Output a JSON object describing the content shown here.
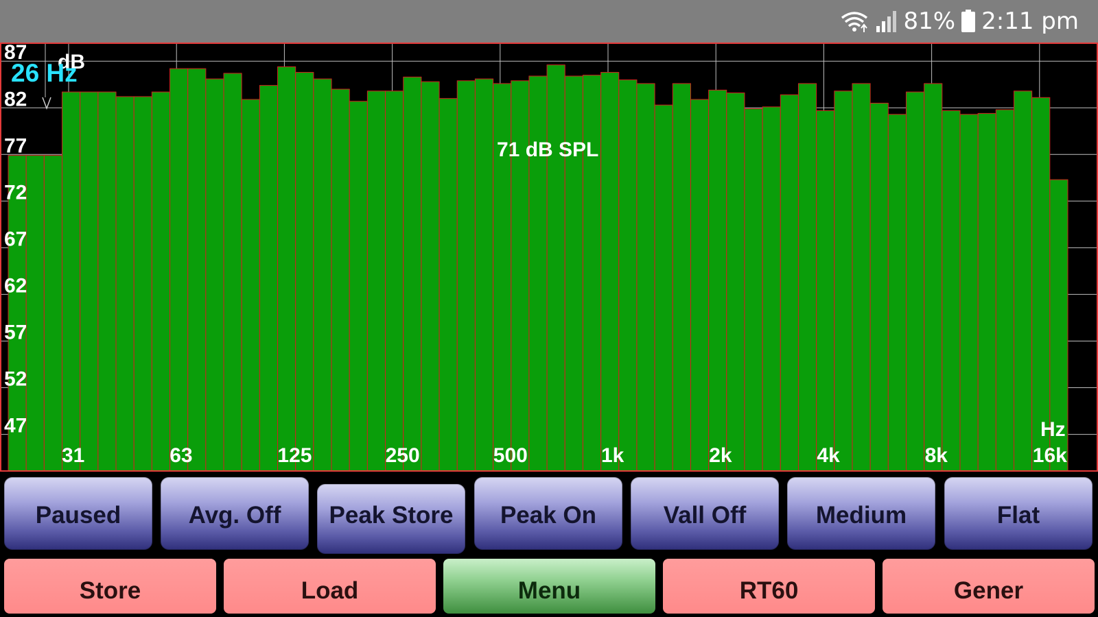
{
  "status": {
    "wifi_icon": "wifi-icon",
    "signal_icon": "signal-icon",
    "battery_percent": "81%",
    "battery_icon": "battery-icon",
    "time": "2:11 pm"
  },
  "analyzer": {
    "spl_readout": "71 dB SPL",
    "cursor_frequency": "26 Hz",
    "db_unit": "dB",
    "hz_unit": "Hz",
    "colors": {
      "bar": "#0a9e0a",
      "bar_edge": "#d12020",
      "frame": "#e43a3a",
      "grid": "#bfbfbf",
      "cursor_text": "#29e2ff"
    }
  },
  "chart_data": {
    "type": "bar",
    "y_ticks": [
      "87",
      "82",
      "77",
      "72",
      "67",
      "62",
      "57",
      "52",
      "47"
    ],
    "ylim": [
      43,
      89
    ],
    "x_ticks": [
      "31",
      "63",
      "125",
      "250",
      "500",
      "1k",
      "2k",
      "4k",
      "8k",
      "16k"
    ],
    "xlabel": "Hz",
    "ylabel": "dB",
    "band_count": 59,
    "values": [
      76.9,
      76.9,
      76.9,
      83.7,
      83.7,
      83.7,
      83.2,
      83.2,
      83.7,
      86.2,
      86.2,
      85.1,
      85.7,
      82.9,
      84.4,
      86.4,
      85.8,
      85.1,
      84.0,
      82.7,
      83.8,
      83.8,
      85.3,
      84.8,
      83.0,
      84.9,
      85.1,
      84.6,
      84.9,
      85.4,
      86.6,
      85.4,
      85.5,
      85.8,
      85.0,
      84.6,
      82.3,
      84.6,
      82.9,
      83.9,
      83.6,
      81.9,
      82.1,
      83.4,
      84.6,
      81.7,
      83.8,
      84.6,
      82.5,
      81.3,
      83.7,
      84.6,
      81.7,
      81.3,
      81.4,
      81.8,
      83.8,
      83.1,
      74.3
    ]
  },
  "controls_row1": [
    "Paused",
    "Avg. Off",
    "Peak Store",
    "Peak On",
    "Vall Off",
    "Medium",
    "Flat"
  ],
  "controls_row2": [
    "Store",
    "Load",
    "Menu",
    "RT60",
    "Gener"
  ]
}
